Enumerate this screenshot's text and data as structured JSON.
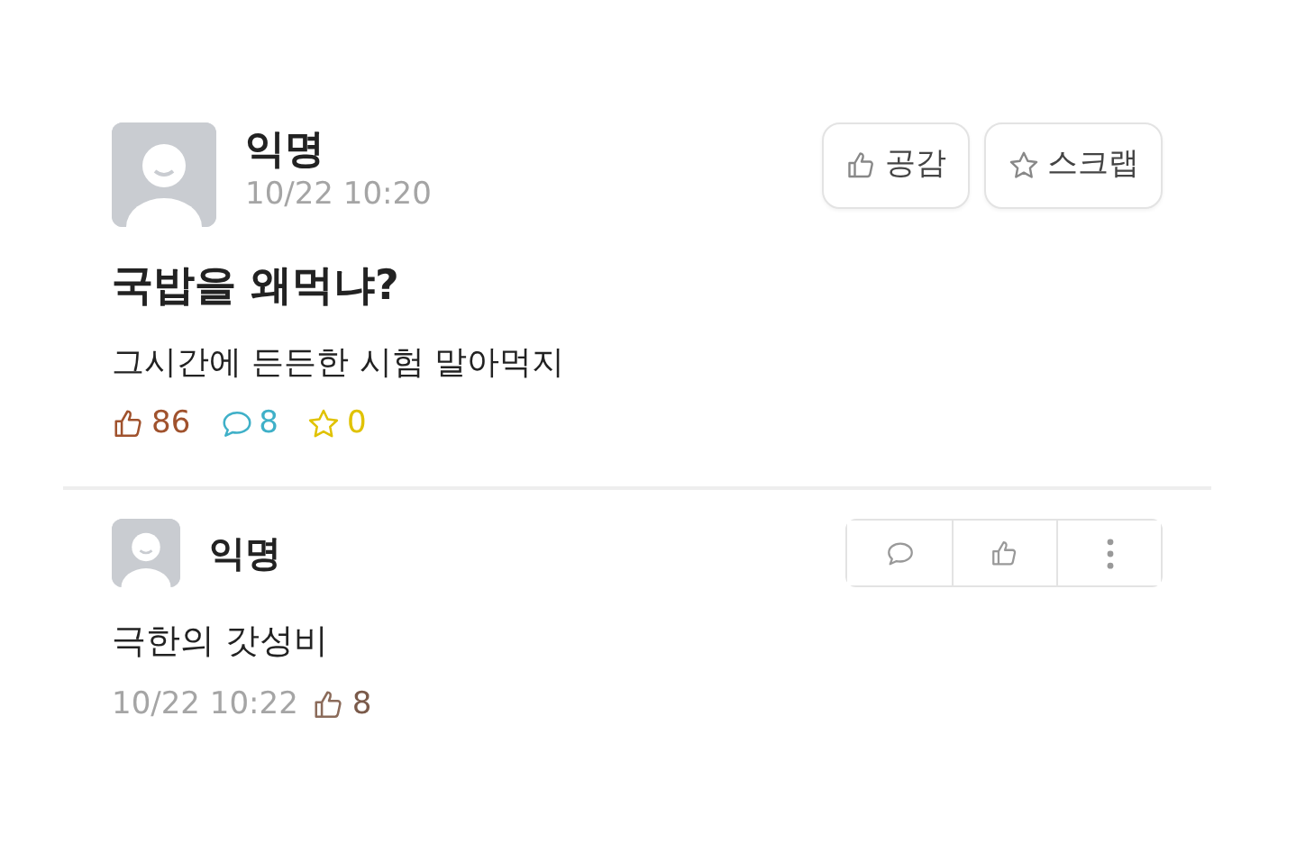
{
  "post": {
    "author": "익명",
    "time": "10/22 10:20",
    "buttons": [
      {
        "kind": "like",
        "label": "공감"
      },
      {
        "kind": "scrap",
        "label": "스크랩"
      }
    ],
    "title": "국밥을 왜먹냐?",
    "body": "그시간에 든든한 시험 말아먹지",
    "stats": [
      {
        "kind": "like",
        "count": "86",
        "color": "#a0522d"
      },
      {
        "kind": "comment",
        "count": "8",
        "color": "#3fb0c8"
      },
      {
        "kind": "scrap",
        "count": "0",
        "color": "#e0c200"
      }
    ]
  },
  "comments": [
    {
      "author": "익명",
      "text": "극한의 갓성비",
      "time": "10/22 10:22",
      "actions": [
        {
          "kind": "comment"
        },
        {
          "kind": "like"
        },
        {
          "kind": "more"
        }
      ],
      "likes": "8"
    }
  ]
}
